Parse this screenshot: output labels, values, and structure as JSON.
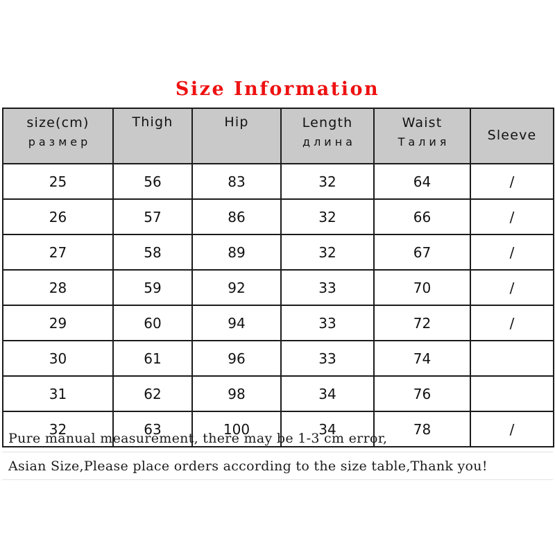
{
  "title": "Size Information",
  "title_color": "#ee1111",
  "header_bg": "#c9c9c9",
  "table": {
    "columns": [
      {
        "en": "size(cm)",
        "ru": "размер"
      },
      {
        "en": "Thigh",
        "ru": ""
      },
      {
        "en": "Hip",
        "ru": ""
      },
      {
        "en": "Length",
        "ru": "длина"
      },
      {
        "en": "Waist",
        "ru": "Талия"
      },
      {
        "en": "Sleeve",
        "ru": ""
      }
    ],
    "rows": [
      {
        "size": "25",
        "thigh": "56",
        "hip": "83",
        "length": "32",
        "waist": "64",
        "sleeve": "/"
      },
      {
        "size": "26",
        "thigh": "57",
        "hip": "86",
        "length": "32",
        "waist": "66",
        "sleeve": "/"
      },
      {
        "size": "27",
        "thigh": "58",
        "hip": "89",
        "length": "32",
        "waist": "67",
        "sleeve": "/"
      },
      {
        "size": "28",
        "thigh": "59",
        "hip": "92",
        "length": "33",
        "waist": "70",
        "sleeve": "/"
      },
      {
        "size": "29",
        "thigh": "60",
        "hip": "94",
        "length": "33",
        "waist": "72",
        "sleeve": "/"
      },
      {
        "size": "30",
        "thigh": "61",
        "hip": "96",
        "length": "33",
        "waist": "74",
        "sleeve": ""
      },
      {
        "size": "31",
        "thigh": "62",
        "hip": "98",
        "length": "34",
        "waist": "76",
        "sleeve": ""
      },
      {
        "size": "32",
        "thigh": "63",
        "hip": "100",
        "length": "34",
        "waist": "78",
        "sleeve": "/"
      }
    ]
  },
  "notes": [
    "Pure manual measurement,  there may be 1-3 cm error,",
    "Asian Size,Please place orders according to the size table,Thank you!"
  ]
}
